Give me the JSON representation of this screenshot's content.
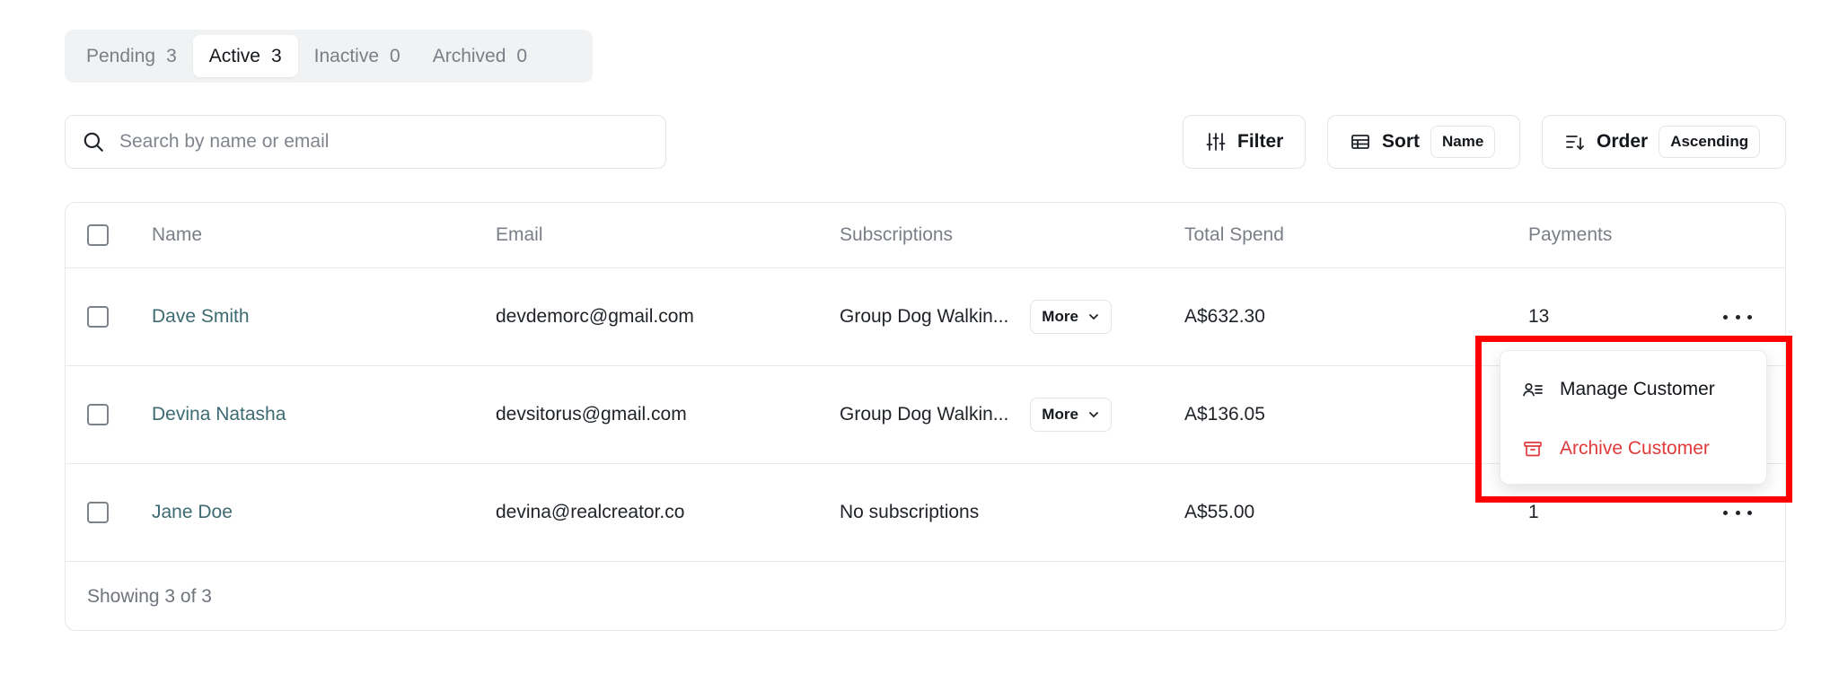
{
  "tabs": [
    {
      "label": "Pending",
      "count": "3"
    },
    {
      "label": "Active",
      "count": "3"
    },
    {
      "label": "Inactive",
      "count": "0"
    },
    {
      "label": "Archived",
      "count": "0"
    }
  ],
  "search": {
    "placeholder": "Search by name or email"
  },
  "toolbar": {
    "filter_label": "Filter",
    "sort_label": "Sort",
    "sort_value": "Name",
    "order_label": "Order",
    "order_value": "Ascending"
  },
  "table": {
    "headers": {
      "name": "Name",
      "email": "Email",
      "subscriptions": "Subscriptions",
      "total_spend": "Total Spend",
      "payments": "Payments"
    },
    "rows": [
      {
        "name": "Dave Smith",
        "email": "devdemorc@gmail.com",
        "subscriptions": "Group Dog Walkin...",
        "more_label": "More",
        "total_spend": "A$632.30",
        "payments": "13"
      },
      {
        "name": "Devina Natasha",
        "email": "devsitorus@gmail.com",
        "subscriptions": "Group Dog Walkin...",
        "more_label": "More",
        "total_spend": "A$136.05",
        "payments": ""
      },
      {
        "name": "Jane Doe",
        "email": "devina@realcreator.co",
        "subscriptions": "No subscriptions",
        "more_label": "",
        "total_spend": "A$55.00",
        "payments": "1"
      }
    ],
    "footer": "Showing 3 of 3"
  },
  "menu": {
    "manage_label": "Manage Customer",
    "archive_label": "Archive Customer"
  },
  "colors": {
    "accent_link": "#3d6b72",
    "danger": "#e03b3b",
    "highlight": "#ff0000"
  }
}
